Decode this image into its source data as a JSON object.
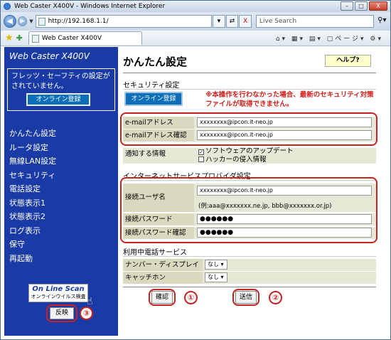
{
  "window": {
    "title": "Web Caster X400V - Windows Internet Explorer",
    "min": "–",
    "max": "□",
    "close": "X"
  },
  "addressbar": {
    "url": "http://192.168.1.1/",
    "go": "⇄",
    "stop": "X",
    "search_placeholder": "Live Search",
    "search_btn": "⚲▾"
  },
  "favbar": {
    "tab_label": "Web Caster X400V",
    "tools": "⌂▾ ▦▾ ▤▾ ▢ページ▾ ⚙▾"
  },
  "sidebar": {
    "brand": "Web Caster X400V",
    "notice": "フレッツ・セーフティの設定がされていません。",
    "register_btn": "オンライン登録",
    "items": [
      {
        "label": "かんたん設定"
      },
      {
        "label": "ルータ設定"
      },
      {
        "label": "無線LAN設定"
      },
      {
        "label": "セキュリティ"
      },
      {
        "label": "電話設定"
      },
      {
        "label": "状態表示1"
      },
      {
        "label": "状態表示2"
      },
      {
        "label": "ログ表示"
      },
      {
        "label": "保守"
      },
      {
        "label": "再起動"
      }
    ],
    "scan_title": "On Line Scan",
    "scan_sub": "オンラインウイルス検査",
    "reflect_btn": "反映",
    "marker3": "③"
  },
  "main": {
    "title": "かんたん設定",
    "help_btn": "ヘルプ?",
    "security": {
      "heading": "セキュリティ設定",
      "register_btn": "オンライン登録",
      "warning": "※本操作を行わなかった場合、最新のセキュリティ対策ファイルが取得できません。",
      "email_label": "e-mailアドレス",
      "email_value": "xxxxxxxx@ipcon.it-neo.jp",
      "email_confirm_label": "e-mailアドレス確認",
      "email_confirm_value": "xxxxxxxx@ipcon.it-neo.jp",
      "notify_label": "通知する情報",
      "notify_opt1": "ソフトウェアのアップデート",
      "notify_opt2": "ハッカーの侵入情報",
      "notify_opt1_checked": "✓",
      "notify_opt2_checked": ""
    },
    "isp": {
      "heading": "インターネットサービスプロバイダ設定",
      "user_label": "接続ユーザ名",
      "user_value": "xxxxxxxx@ipcon.it-neo.jp",
      "user_example": "(例:aaa@xxxxxxx.ne.jp, bbb@xxxxxxx.or.jp)",
      "pass_label": "接続パスワード",
      "pass_value": "●●●●●●",
      "pass_confirm_label": "接続パスワード確認",
      "pass_confirm_value": "●●●●●●"
    },
    "phone": {
      "heading": "利用中電話サービス",
      "display_label": "ナンバー・ディスプレイ",
      "display_value": "なし ▾",
      "catch_label": "キャッチホン",
      "catch_value": "なし ▾"
    },
    "confirm_btn": "確認",
    "send_btn": "送信",
    "marker1": "①",
    "marker2": "②"
  }
}
